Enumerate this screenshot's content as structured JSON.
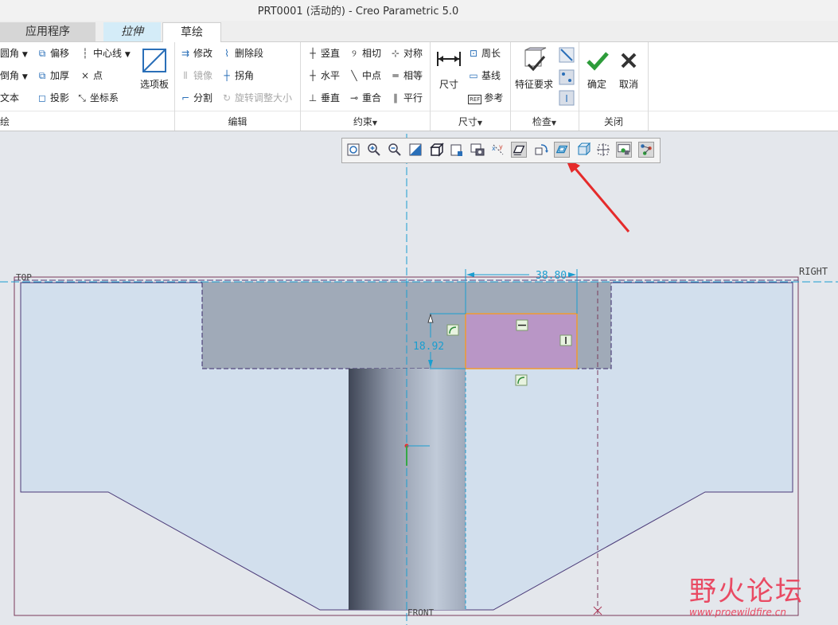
{
  "window": {
    "title": "PRT0001 (活动的) - Creo Parametric 5.0"
  },
  "tabs": {
    "apps": "应用程序",
    "extrude": "拉伸",
    "sketch": "草绘"
  },
  "ribbon": {
    "sketch_group": {
      "fillet": "圆角",
      "chamfer": "倒角",
      "text": "文本",
      "offset": "偏移",
      "thicken": "加厚",
      "project": "投影",
      "centerline": "中心线",
      "point": "点",
      "coord_sys": "坐标系",
      "palette": "选项板",
      "label": "绘"
    },
    "edit_group": {
      "modify": "修改",
      "delete_segment": "删除段",
      "mirror": "镜像",
      "corner": "拐角",
      "divide": "分割",
      "rotate_resize": "旋转调整大小",
      "label": "编辑"
    },
    "constrain_group": {
      "vertical": "竖直",
      "tangent": "相切",
      "symmetric": "对称",
      "horizontal": "水平",
      "midpoint": "中点",
      "equal": "相等",
      "perpendicular": "垂直",
      "coincident": "重合",
      "parallel": "平行",
      "label": "约束"
    },
    "dimension_group": {
      "dimension": "尺寸",
      "perimeter": "周长",
      "baseline": "基线",
      "reference": "参考",
      "ref_badge": "REF",
      "label": "尺寸"
    },
    "inspect_group": {
      "feature_req": "特征要求",
      "label": "检查"
    },
    "close_group": {
      "ok": "确定",
      "cancel": "取消",
      "label": "关闭"
    }
  },
  "canvas": {
    "datum_labels": {
      "top": "TOP",
      "right": "RIGHT",
      "front": "FRONT"
    },
    "dimensions": {
      "width": "38.80",
      "height": "18.92"
    }
  },
  "watermark": {
    "cn": "野火论坛",
    "url": "www.proewildfire.cn"
  },
  "colors": {
    "accent": "#1a9ed0",
    "profile_fill": "#d2dfed",
    "dark_fill": "#a0aab8",
    "selected": "#b996c6",
    "selected_edge": "#f09a30",
    "arrow": "#e52b2b"
  }
}
